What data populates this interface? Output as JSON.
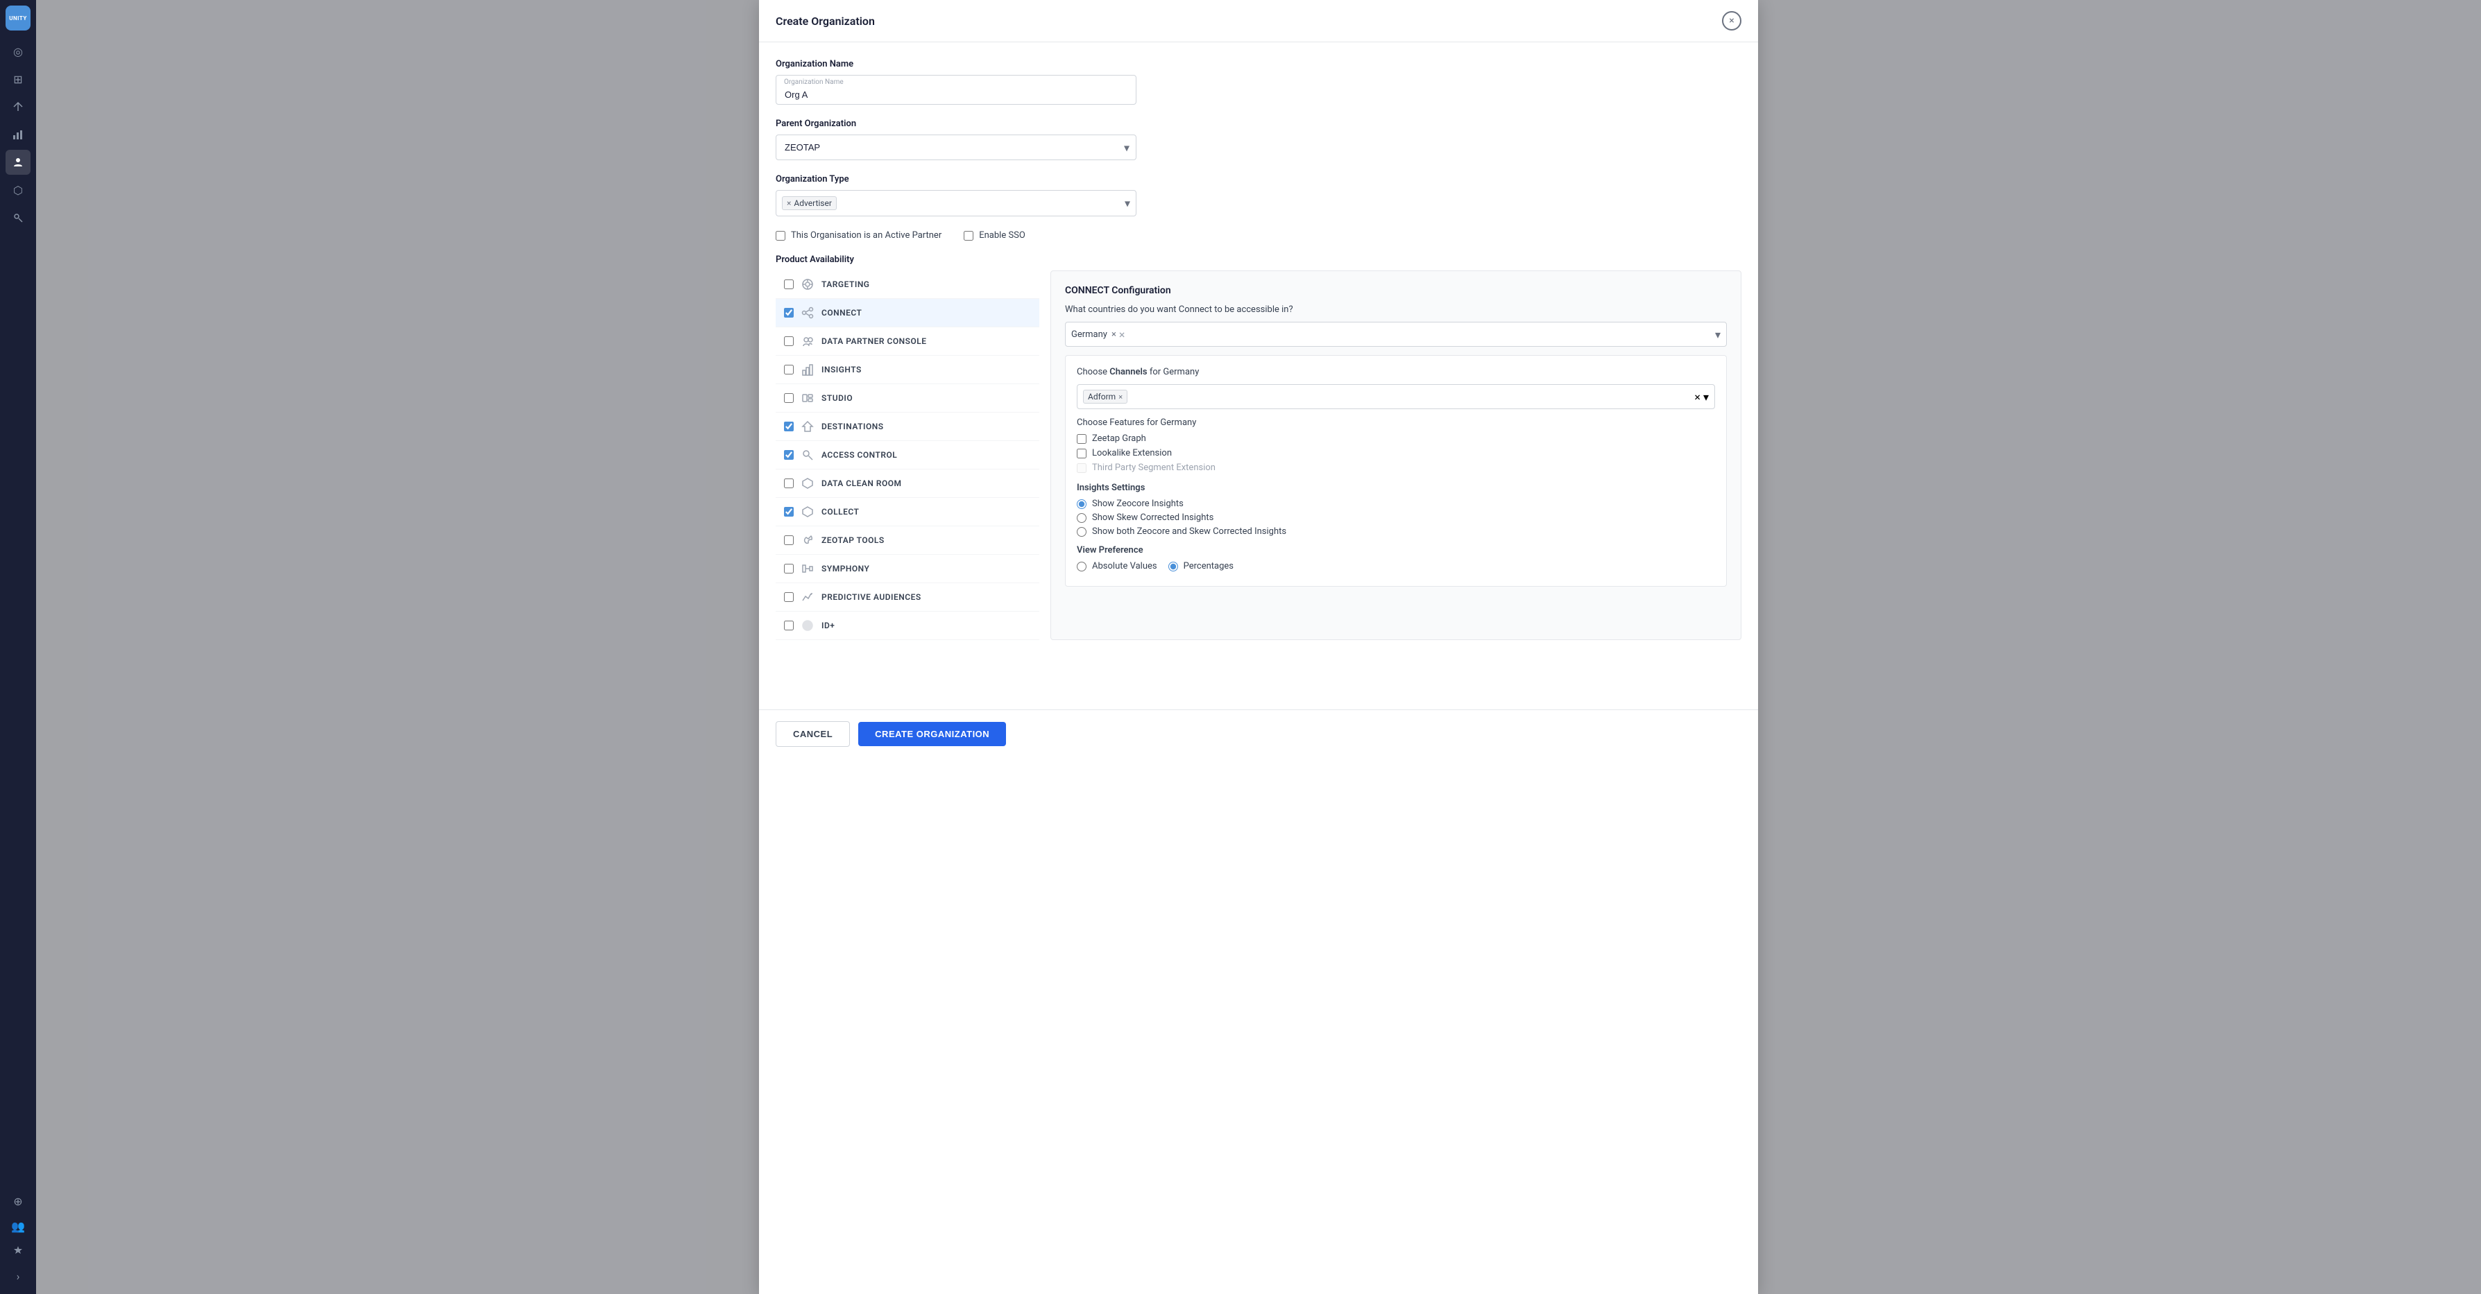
{
  "app": {
    "name": "UNITY"
  },
  "modal": {
    "title": "Create Organization",
    "close_label": "×"
  },
  "form": {
    "org_name_label": "Organization Name",
    "org_name_placeholder": "Organization Name",
    "org_name_value": "Org A",
    "parent_org_label": "Parent Organization",
    "parent_org_value": "ZEOTAP",
    "org_type_label": "Organization Type",
    "org_type_value": "Advertiser",
    "active_partner_label": "This Organisation is an Active Partner",
    "enable_sso_label": "Enable SSO"
  },
  "product_availability": {
    "section_label": "Product Availability",
    "products": [
      {
        "name": "TARGETING",
        "icon": "⚙",
        "checked": false,
        "selected": false
      },
      {
        "name": "CONNECT",
        "icon": "↗",
        "checked": true,
        "selected": true
      },
      {
        "name": "DATA PARTNER CONSOLE",
        "icon": "👥",
        "checked": false,
        "selected": false
      },
      {
        "name": "INSIGHTS",
        "icon": "📊",
        "checked": false,
        "selected": false
      },
      {
        "name": "STUDIO",
        "icon": "🔀",
        "checked": false,
        "selected": false
      },
      {
        "name": "DESTINATIONS",
        "icon": "🎯",
        "checked": true,
        "selected": false
      },
      {
        "name": "ACCESS CONTROL",
        "icon": "🔍",
        "checked": true,
        "selected": false
      },
      {
        "name": "DATA CLEAN ROOM",
        "icon": "🛡",
        "checked": false,
        "selected": false
      },
      {
        "name": "COLLECT",
        "icon": "⬡",
        "checked": true,
        "selected": false
      },
      {
        "name": "ZEOTAP TOOLS",
        "icon": "🔧",
        "checked": false,
        "selected": false
      },
      {
        "name": "SYMPHONY",
        "icon": "⊢",
        "checked": false,
        "selected": false
      },
      {
        "name": "PREDICTIVE AUDIENCES",
        "icon": "📈",
        "checked": false,
        "selected": false
      },
      {
        "name": "ID+",
        "icon": "⬤",
        "checked": false,
        "selected": false
      }
    ]
  },
  "connect_config": {
    "title": "CONNECT Configuration",
    "question": "What countries do you want Connect to be accessible in?",
    "country": "Germany",
    "channels_title_prefix": "Choose",
    "channels_title_mid": "Channels",
    "channels_title_suffix": "for",
    "channels_country": "Germany",
    "channel_value": "Adform",
    "features_title": "Choose Features for Germany",
    "features": [
      {
        "label": "Zeetap Graph",
        "checked": false,
        "disabled": false
      },
      {
        "label": "Lookalike Extension",
        "checked": false,
        "disabled": false
      },
      {
        "label": "Third Party Segment Extension",
        "checked": false,
        "disabled": true
      }
    ],
    "insights_settings_title": "Insights Settings",
    "insights_options": [
      {
        "label": "Show Zeocore Insights",
        "selected": true
      },
      {
        "label": "Show Skew Corrected Insights",
        "selected": false
      },
      {
        "label": "Show both Zeocore and Skew Corrected Insights",
        "selected": false
      }
    ],
    "view_pref_title": "View Preference",
    "view_options": [
      {
        "label": "Absolute Values",
        "selected": false
      },
      {
        "label": "Percentages",
        "selected": true
      }
    ]
  },
  "footer": {
    "cancel_label": "CANCEL",
    "create_label": "CREATE ORGANIZATION"
  },
  "sidebar": {
    "items": [
      {
        "icon": "◎",
        "name": "home"
      },
      {
        "icon": "⊞",
        "name": "grid"
      },
      {
        "icon": "↗",
        "name": "connect"
      },
      {
        "icon": "📊",
        "name": "insights"
      },
      {
        "icon": "◉",
        "name": "audiences"
      },
      {
        "icon": "⬡",
        "name": "collect"
      },
      {
        "icon": "👤",
        "name": "identity"
      },
      {
        "icon": "⊕",
        "name": "add"
      },
      {
        "icon": "👥",
        "name": "users"
      },
      {
        "icon": "🔧",
        "name": "tools"
      }
    ]
  }
}
